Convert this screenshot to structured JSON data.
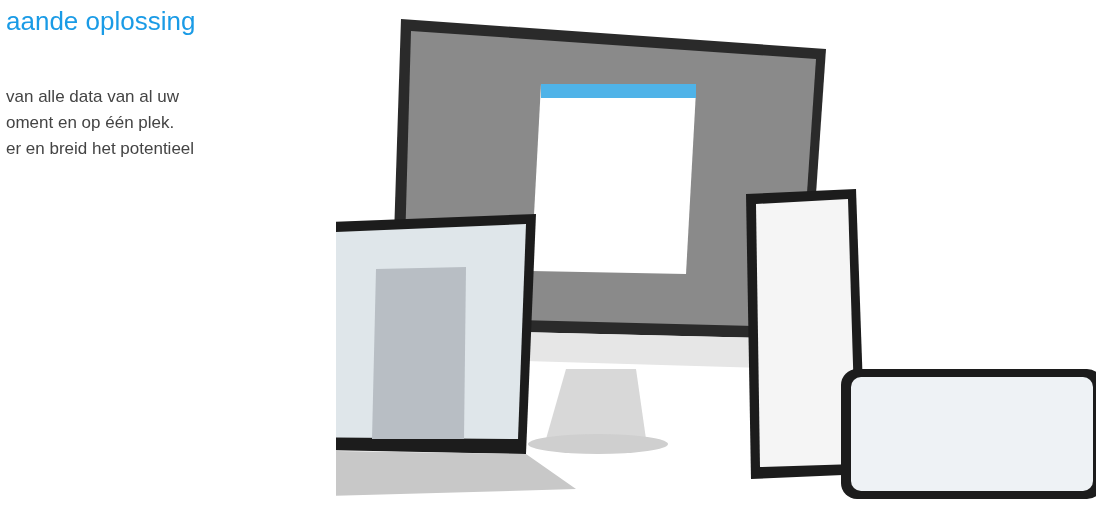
{
  "heading": "aande oplossing",
  "paragraph_lines": [
    "van alle data van al uw",
    "oment en op één plek.",
    "er en breid het potentieel"
  ]
}
